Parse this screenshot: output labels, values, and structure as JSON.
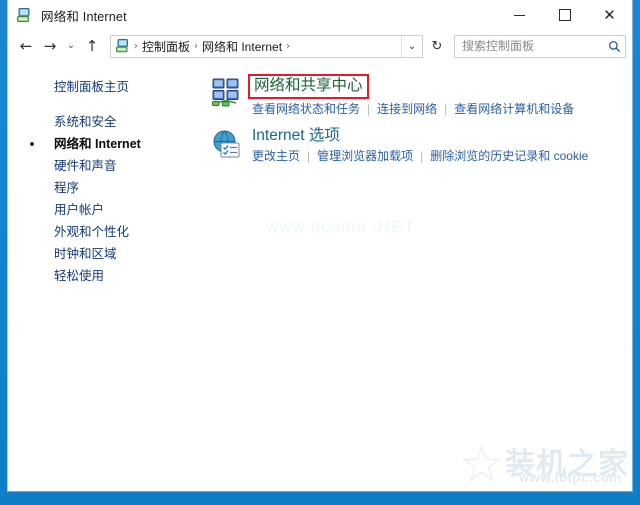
{
  "window": {
    "title": "网络和 Internet",
    "icon": "network-internet-icon",
    "minimize_label": "–",
    "maximize_label": "□",
    "close_label": "✕"
  },
  "nav": {
    "back_label": "←",
    "forward_label": "→",
    "history_label": "⌄",
    "up_label": "↑",
    "refresh_label": "↻",
    "address_chevron": "⌄",
    "breadcrumbs": [
      {
        "label": "控制面板",
        "sep": "›"
      },
      {
        "label": "网络和 Internet",
        "sep": "›"
      }
    ]
  },
  "search": {
    "placeholder": "搜索控制面板",
    "value": "",
    "icon": "search-icon"
  },
  "sidebar": {
    "items": [
      {
        "label": "控制面板主页",
        "active": false,
        "gap": false
      },
      {
        "label": "系统和安全",
        "active": false,
        "gap": true
      },
      {
        "label": "网络和 Internet",
        "active": true,
        "gap": false
      },
      {
        "label": "硬件和声音",
        "active": false,
        "gap": false
      },
      {
        "label": "程序",
        "active": false,
        "gap": false
      },
      {
        "label": "用户帐户",
        "active": false,
        "gap": false
      },
      {
        "label": "外观和个性化",
        "active": false,
        "gap": false
      },
      {
        "label": "时钟和区域",
        "active": false,
        "gap": false
      },
      {
        "label": "轻松使用",
        "active": false,
        "gap": false
      }
    ]
  },
  "main": {
    "categories": [
      {
        "title": "网络和共享中心",
        "icon": "network-sharing-center-icon",
        "highlighted": true,
        "highlight_color": "#e8192c",
        "title_color": "#1c6434",
        "links": [
          "查看网络状态和任务",
          "连接到网络",
          "查看网络计算机和设备"
        ]
      },
      {
        "title": "Internet 选项",
        "icon": "internet-options-icon",
        "highlighted": false,
        "title_color": "#17698c",
        "links": [
          "更改主页",
          "管理浏览器加载项",
          "删除浏览的历史记录和 cookie"
        ]
      }
    ],
    "center_watermark": "www.pc6ma .NET"
  },
  "watermark": {
    "star": "★",
    "brand": "装机之家",
    "url": "www.lotpc.com"
  }
}
